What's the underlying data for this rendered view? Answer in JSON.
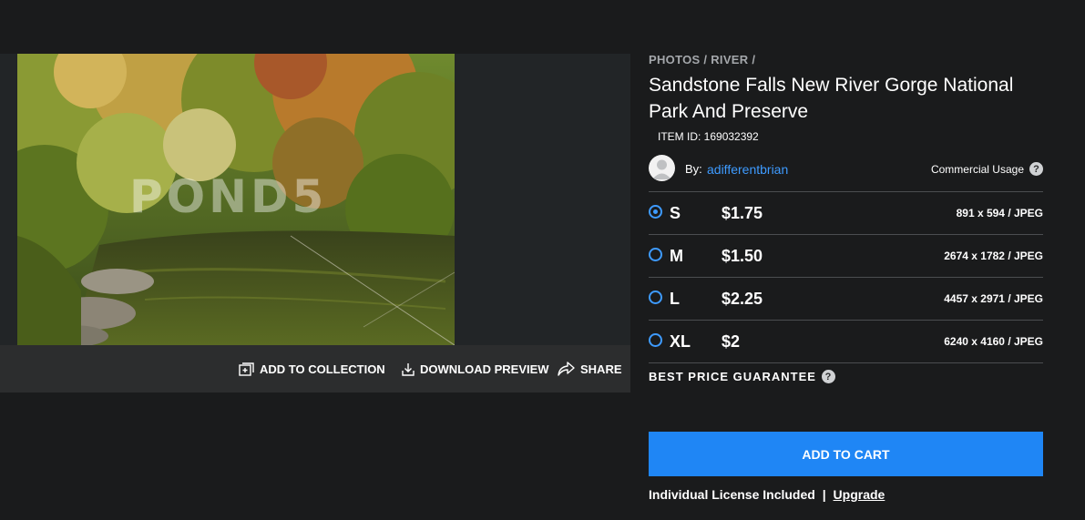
{
  "media": {
    "watermark": "POND5",
    "actions": {
      "add_to_collection": "ADD TO COLLECTION",
      "download_preview": "DOWNLOAD PREVIEW",
      "share": "SHARE"
    }
  },
  "details": {
    "breadcrumb": [
      "PHOTOS",
      "/",
      "RIVER",
      "/"
    ],
    "title": "Sandstone Falls New River Gorge National Park And Preserve",
    "item_id": "ITEM ID: 169032392",
    "by_label": "By:",
    "author": "adifferentbrian",
    "usage": "Commercial Usage",
    "help_glyph": "?"
  },
  "sizes": [
    {
      "code": "S",
      "price": "$1.75",
      "dims": "891 x 594 / JPEG",
      "selected": true
    },
    {
      "code": "M",
      "price": "$1.50",
      "dims": "2674 x 1782 / JPEG",
      "selected": false
    },
    {
      "code": "L",
      "price": "$2.25",
      "dims": "4457 x 2971 / JPEG",
      "selected": false
    },
    {
      "code": "XL",
      "price": "$2",
      "dims": "6240 x 4160 / JPEG",
      "selected": false
    }
  ],
  "guarantee": "BEST PRICE GUARANTEE",
  "cart": {
    "label": "ADD TO CART"
  },
  "license": {
    "text": "Individual License Included",
    "separator": "|",
    "upgrade": "Upgrade"
  },
  "colors": {
    "accent": "#1f86f5",
    "link": "#3e9bff",
    "background": "#1a1b1c"
  }
}
